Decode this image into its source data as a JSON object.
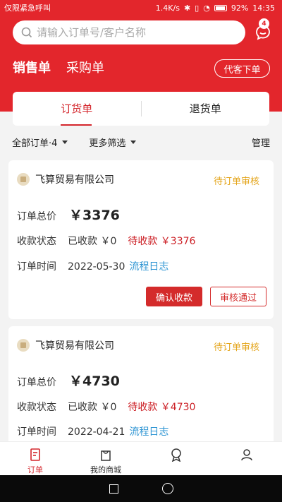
{
  "status_bar": {
    "left_text": "仅限紧急呼叫",
    "speed": "1.4K/s",
    "battery": "92%",
    "time": "14:35"
  },
  "search": {
    "placeholder": "请输入订单号/客户名称"
  },
  "message": {
    "badge": "4",
    "icon": "message-icon"
  },
  "order_types": [
    {
      "label": "销售单",
      "active": true
    },
    {
      "label": "采购单",
      "active": false
    }
  ],
  "proxy_order_label": "代客下单",
  "segments": [
    {
      "label": "订货单",
      "active": true
    },
    {
      "label": "退货单",
      "active": false
    }
  ],
  "filters": {
    "all_orders": "全部订单·4",
    "more_filters": "更多筛选",
    "manage": "管理"
  },
  "orders": [
    {
      "company": "飞算贸易有限公司",
      "status": "待订单审核",
      "total_label": "订单总价",
      "total": "￥3376",
      "payment_label": "收款状态",
      "received": "已收款 ￥0",
      "pending": "待收款 ￥3376",
      "time_label": "订单时间",
      "date": "2022-05-30",
      "log_link": "流程日志",
      "confirm_label": "确认收款",
      "approve_label": "审核通过"
    },
    {
      "company": "飞算贸易有限公司",
      "status": "待订单审核",
      "total_label": "订单总价",
      "total": "￥4730",
      "payment_label": "收款状态",
      "received": "已收款 ￥0",
      "pending": "待收款 ￥4730",
      "time_label": "订单时间",
      "date": "2022-04-21",
      "log_link": "流程日志"
    }
  ],
  "tabbar": [
    {
      "label": "订单",
      "icon": "order-icon",
      "active": true
    },
    {
      "label": "我的商城",
      "icon": "store-icon",
      "active": false
    },
    {
      "label": "",
      "icon": "badge-icon",
      "active": false
    },
    {
      "label": "",
      "icon": "user-icon",
      "active": false
    }
  ],
  "colors": {
    "primary": "#e3262c",
    "pending_status": "#e4a51b",
    "link": "#2e95d3"
  }
}
